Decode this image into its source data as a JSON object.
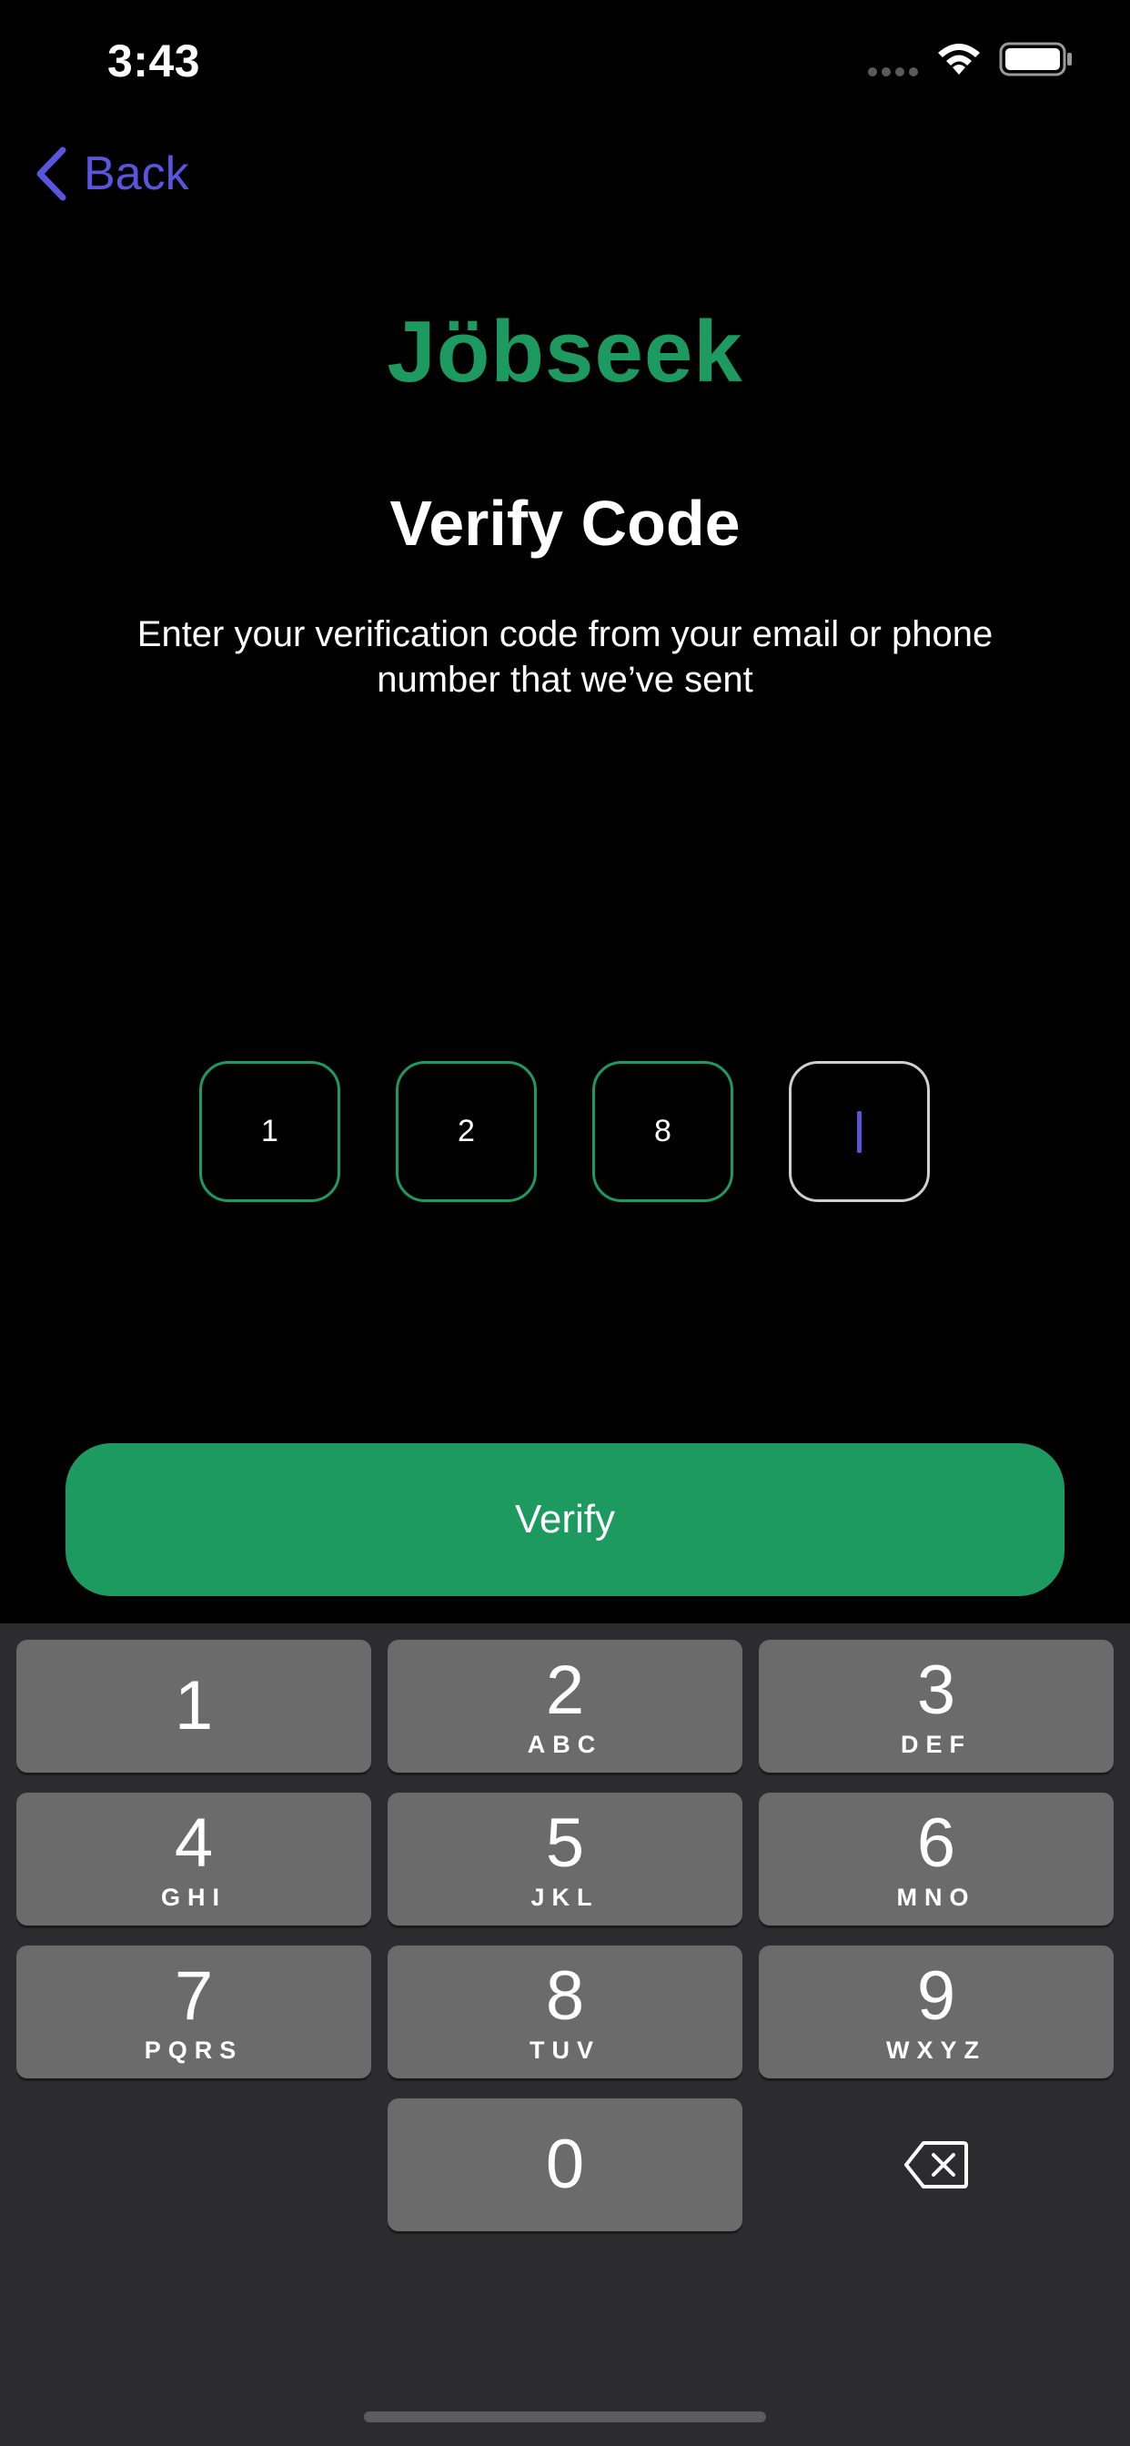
{
  "status_bar": {
    "time": "3:43"
  },
  "nav": {
    "back_label": "Back"
  },
  "brand": {
    "name": "Jöbseek"
  },
  "header": {
    "title": "Verify Code",
    "subtitle": "Enter your verification code from your email or phone number that we’ve sent"
  },
  "code": {
    "digits": [
      "1",
      "2",
      "8",
      ""
    ],
    "active_index": 3
  },
  "verify_button": {
    "label": "Verify"
  },
  "keypad": {
    "keys": [
      {
        "digit": "1",
        "letters": ""
      },
      {
        "digit": "2",
        "letters": "ABC"
      },
      {
        "digit": "3",
        "letters": "DEF"
      },
      {
        "digit": "4",
        "letters": "GHI"
      },
      {
        "digit": "5",
        "letters": "JKL"
      },
      {
        "digit": "6",
        "letters": "MNO"
      },
      {
        "digit": "7",
        "letters": "PQRS"
      },
      {
        "digit": "8",
        "letters": "TUV"
      },
      {
        "digit": "9",
        "letters": "WXYZ"
      },
      {
        "digit": "0",
        "letters": ""
      }
    ]
  },
  "colors": {
    "brand_green": "#1c9a5f",
    "accent_purple": "#5a55df",
    "key_gray": "#6b6b6b",
    "keyboard_bg": "#2c2c2e"
  }
}
